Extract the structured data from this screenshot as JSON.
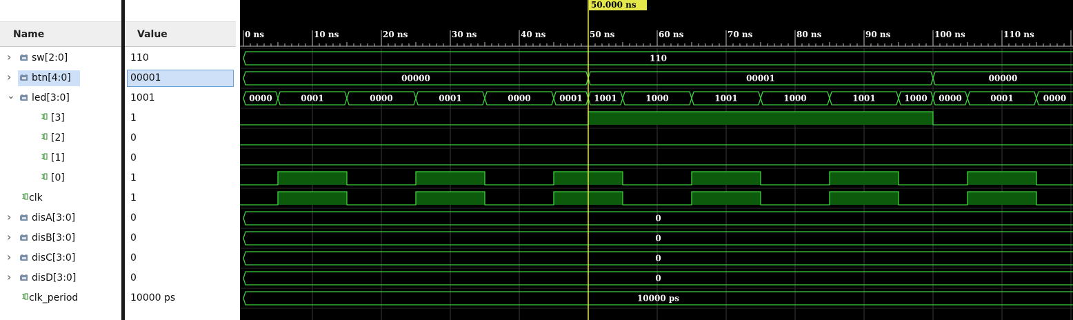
{
  "headers": {
    "name": "Name",
    "value": "Value"
  },
  "cursor": {
    "label": "50.000 ns",
    "time_ns": 50
  },
  "timeline": {
    "ticks": [
      "0 ns",
      "10 ns",
      "20 ns",
      "30 ns",
      "40 ns",
      "50 ns",
      "60 ns",
      "70 ns",
      "80 ns",
      "90 ns",
      "100 ns",
      "110 ns"
    ]
  },
  "signals": [
    {
      "name": "sw[2:0]",
      "value": "110",
      "kind": "bus",
      "expandable": true,
      "expanded": false,
      "indent": 0,
      "selected": false
    },
    {
      "name": "btn[4:0]",
      "value": "00001",
      "kind": "bus",
      "expandable": true,
      "expanded": false,
      "indent": 0,
      "selected": true
    },
    {
      "name": "led[3:0]",
      "value": "1001",
      "kind": "bus",
      "expandable": true,
      "expanded": true,
      "indent": 0,
      "selected": false
    },
    {
      "name": "[3]",
      "value": "1",
      "kind": "bit",
      "expandable": false,
      "indent": 2,
      "selected": false
    },
    {
      "name": "[2]",
      "value": "0",
      "kind": "bit",
      "expandable": false,
      "indent": 2,
      "selected": false
    },
    {
      "name": "[1]",
      "value": "0",
      "kind": "bit",
      "expandable": false,
      "indent": 2,
      "selected": false
    },
    {
      "name": "[0]",
      "value": "1",
      "kind": "bit",
      "expandable": false,
      "indent": 2,
      "selected": false
    },
    {
      "name": "clk",
      "value": "1",
      "kind": "bit",
      "expandable": false,
      "indent": 1,
      "selected": false
    },
    {
      "name": "disA[3:0]",
      "value": "0",
      "kind": "bus",
      "expandable": true,
      "expanded": false,
      "indent": 0,
      "selected": false
    },
    {
      "name": "disB[3:0]",
      "value": "0",
      "kind": "bus",
      "expandable": true,
      "expanded": false,
      "indent": 0,
      "selected": false
    },
    {
      "name": "disC[3:0]",
      "value": "0",
      "kind": "bus",
      "expandable": true,
      "expanded": false,
      "indent": 0,
      "selected": false
    },
    {
      "name": "disD[3:0]",
      "value": "0",
      "kind": "bus",
      "expandable": true,
      "expanded": false,
      "indent": 0,
      "selected": false
    },
    {
      "name": "clk_period",
      "value": "10000 ps",
      "kind": "bit",
      "expandable": false,
      "indent": 1,
      "selected": false
    }
  ],
  "waveforms": [
    {
      "type": "bus",
      "segments": [
        {
          "start": 0,
          "end": 121,
          "label": "110"
        }
      ]
    },
    {
      "type": "bus",
      "segments": [
        {
          "start": 0,
          "end": 50,
          "label": "00000"
        },
        {
          "start": 50,
          "end": 100,
          "label": "00001"
        },
        {
          "start": 100,
          "end": 121,
          "label": "00000"
        }
      ]
    },
    {
      "type": "bus",
      "segments": [
        {
          "start": 0,
          "end": 5,
          "label": "0000"
        },
        {
          "start": 5,
          "end": 15,
          "label": "0001"
        },
        {
          "start": 15,
          "end": 25,
          "label": "0000"
        },
        {
          "start": 25,
          "end": 35,
          "label": "0001"
        },
        {
          "start": 35,
          "end": 45,
          "label": "0000"
        },
        {
          "start": 45,
          "end": 50,
          "label": "0001"
        },
        {
          "start": 50,
          "end": 55,
          "label": "1001"
        },
        {
          "start": 55,
          "end": 65,
          "label": "1000"
        },
        {
          "start": 65,
          "end": 75,
          "label": "1001"
        },
        {
          "start": 75,
          "end": 85,
          "label": "1000"
        },
        {
          "start": 85,
          "end": 95,
          "label": "1001"
        },
        {
          "start": 95,
          "end": 100,
          "label": "1000"
        },
        {
          "start": 100,
          "end": 105,
          "label": "0000"
        },
        {
          "start": 105,
          "end": 115,
          "label": "0001"
        },
        {
          "start": 115,
          "end": 121,
          "label": "0000"
        }
      ]
    },
    {
      "type": "bit",
      "highs": [
        [
          50,
          100
        ]
      ]
    },
    {
      "type": "bit",
      "highs": []
    },
    {
      "type": "bit",
      "highs": []
    },
    {
      "type": "bit",
      "highs": [
        [
          5,
          15
        ],
        [
          25,
          35
        ],
        [
          45,
          55
        ],
        [
          65,
          75
        ],
        [
          85,
          95
        ],
        [
          105,
          115
        ]
      ]
    },
    {
      "type": "bit",
      "highs": [
        [
          5,
          15
        ],
        [
          25,
          35
        ],
        [
          45,
          55
        ],
        [
          65,
          75
        ],
        [
          85,
          95
        ],
        [
          105,
          115
        ]
      ]
    },
    {
      "type": "bus",
      "segments": [
        {
          "start": 0,
          "end": 121,
          "label": "0"
        }
      ]
    },
    {
      "type": "bus",
      "segments": [
        {
          "start": 0,
          "end": 121,
          "label": "0"
        }
      ]
    },
    {
      "type": "bus",
      "segments": [
        {
          "start": 0,
          "end": 121,
          "label": "0"
        }
      ]
    },
    {
      "type": "bus",
      "segments": [
        {
          "start": 0,
          "end": 121,
          "label": "0"
        }
      ]
    },
    {
      "type": "bus",
      "segments": [
        {
          "start": 0,
          "end": 121,
          "label": "10000 ps"
        }
      ]
    }
  ],
  "colors": {
    "wave": "#3fd03f",
    "high_fill": "#0d5a0d",
    "cursor": "#e5e84a",
    "grid": "#3a3a3a",
    "tick": "#bfbfbf",
    "text": "#ffffff",
    "selection": "#cde0f7"
  }
}
